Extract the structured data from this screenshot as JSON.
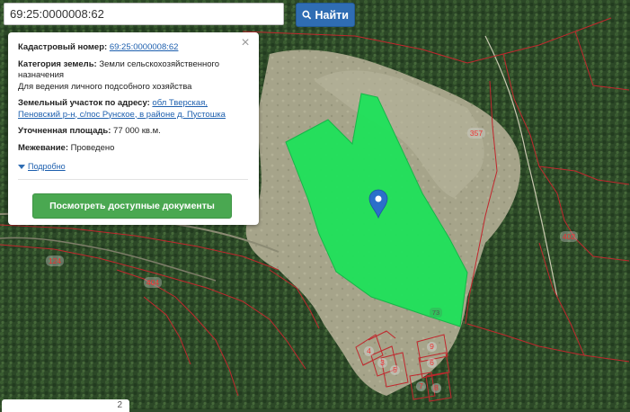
{
  "search": {
    "value": "69:25:0000008:62",
    "button_label": "Найти"
  },
  "popup": {
    "cadastral_label": "Кадастровый номер:",
    "cadastral_value": "69:25:0000008:62",
    "category_label": "Категория земель:",
    "category_value": "Земли сельскохозяйственного назначения",
    "usage_value": "Для ведения личного подсобного хозяйства",
    "address_label": "Земельный участок по адресу:",
    "address_value": "обл Тверская, Пеновский р-н, с/пос Рунское, в районе д. Пустошка",
    "area_label": "Уточненная площадь:",
    "area_value": "77 000 кв.м.",
    "survey_label": "Межевание:",
    "survey_value": "Проведено",
    "more_label": "Подробно",
    "docs_button": "Посмотреть доступные документы",
    "close_symbol": "×"
  },
  "map_labels": {
    "l357": "357",
    "l402": "402",
    "l124": "124",
    "l404": "404",
    "l73": "73",
    "l4": "4",
    "l3": "3",
    "l5": "5",
    "l9": "9",
    "l6": "6",
    "l7": "7",
    "l8": "8"
  },
  "bottom_hint": "2",
  "colors": {
    "parcel_fill": "#1de25a",
    "boundary": "#c1272d",
    "marker": "#2b6fca",
    "button_blue": "#2f6db3",
    "button_green": "#4aa851"
  },
  "icons": {
    "search": "search-icon",
    "marker": "map-marker-icon",
    "close": "close-icon",
    "expand": "triangle-down-icon"
  }
}
